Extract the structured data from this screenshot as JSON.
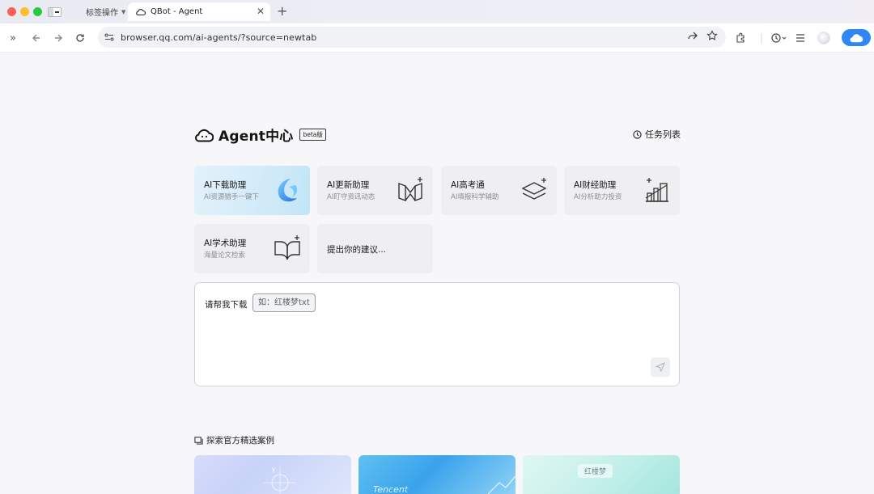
{
  "browser": {
    "tab_group_label": "标签操作",
    "active_tab_title": "QBot - Agent",
    "url": "browser.qq.com/ai-agents/?source=newtab"
  },
  "brand": {
    "title": "Agent中心",
    "badge": "beta版"
  },
  "task_list_label": "任务列表",
  "cards": [
    {
      "title": "AI下载助理",
      "subtitle": "AI资源猎手一键下",
      "icon": "blue-swirl-icon"
    },
    {
      "title": "AI更新助理",
      "subtitle": "AI盯守资讯动态",
      "icon": "book-sparkle-icon"
    },
    {
      "title": "AI高考通",
      "subtitle": "AI填报科学辅助",
      "icon": "layers-icon"
    },
    {
      "title": "AI财经助理",
      "subtitle": "AI分析助力投资",
      "icon": "chart-icon"
    },
    {
      "title": "AI学术助理",
      "subtitle": "海量论文检索",
      "icon": "open-book-icon"
    }
  ],
  "suggestion_label": "提出你的建议...",
  "prompt": {
    "prefix": "请帮我下载",
    "example_chip": "如：红楼梦txt"
  },
  "explore_label": "探索官方精选案例",
  "case_cards": [
    {
      "text": ""
    },
    {
      "text": "Tencent"
    },
    {
      "text": "红楼梦"
    }
  ],
  "colors": {
    "accent_blue": "#2f87f5",
    "active_card": "#cfe9f8"
  }
}
